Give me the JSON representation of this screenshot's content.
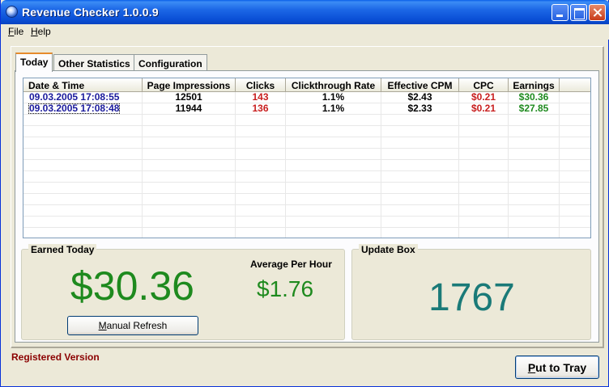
{
  "window": {
    "title": "Revenue Checker 1.0.0.9"
  },
  "menu": {
    "file": {
      "accel": "F",
      "rest": "ile"
    },
    "help": {
      "accel": "H",
      "rest": "elp"
    }
  },
  "tabs": [
    {
      "label": "Today",
      "active": true
    },
    {
      "label": "Other Statistics",
      "active": false
    },
    {
      "label": "Configuration",
      "active": false
    }
  ],
  "table": {
    "columns": [
      "Date & Time",
      "Page Impressions",
      "Clicks",
      "Clickthrough Rate",
      "Effective CPM",
      "CPC",
      "Earnings"
    ],
    "rows": [
      {
        "datetime": "09.03.2005 17:08:55",
        "impressions": "12501",
        "clicks": "143",
        "ctr": "1.1%",
        "cpm": "$2.43",
        "cpc": "$0.21",
        "earnings": "$30.36"
      },
      {
        "datetime": "09.03.2005 17:08:48",
        "impressions": "11944",
        "clicks": "136",
        "ctr": "1.1%",
        "cpm": "$2.33",
        "cpc": "$0.21",
        "earnings": "$27.85"
      }
    ]
  },
  "earned_today": {
    "label": "Earned Today",
    "amount": "$30.36",
    "avg_label": "Average Per Hour",
    "avg_value": "$1.76",
    "refresh": {
      "accel": "M",
      "rest": "anual Refresh"
    }
  },
  "update_box": {
    "label": "Update Box",
    "value": "1767"
  },
  "status": {
    "registered": "Registered Version"
  },
  "tray_button": {
    "accel": "P",
    "rest": "ut to Tray"
  },
  "colors": {
    "date_text": "#1a1a9c",
    "clicks_text": "#c81e1e",
    "cpc_text": "#c81e1e",
    "earnings_text": "#1e8a1e",
    "earned_amount": "#1e8a1e",
    "update_value": "#1a7a78",
    "registered_text": "#8b0000"
  }
}
